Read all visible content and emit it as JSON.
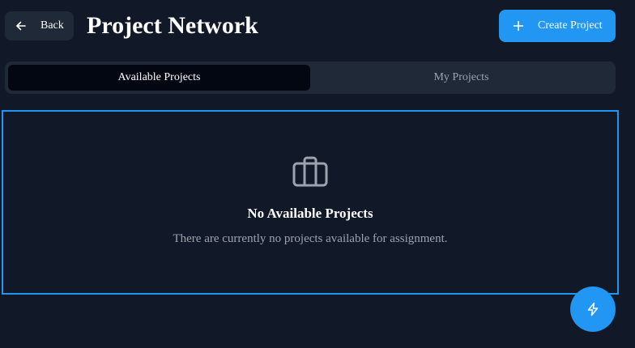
{
  "header": {
    "back_label": "Back",
    "back_icon": "arrow-left-icon",
    "title": "Project Network",
    "create_label": "Create Project",
    "create_icon": "plus-icon"
  },
  "tabs": [
    {
      "label": "Available Projects",
      "active": true
    },
    {
      "label": "My Projects",
      "active": false
    }
  ],
  "empty_state": {
    "icon": "briefcase-icon",
    "title": "No Available Projects",
    "description": "There are currently no projects available for assignment."
  },
  "fab": {
    "icon": "lightning-icon"
  },
  "colors": {
    "background": "#111827",
    "surface": "#1f2937",
    "accent": "#2196f3",
    "active_tab": "#030712",
    "muted_text": "#9ca3af",
    "text": "#ffffff"
  }
}
